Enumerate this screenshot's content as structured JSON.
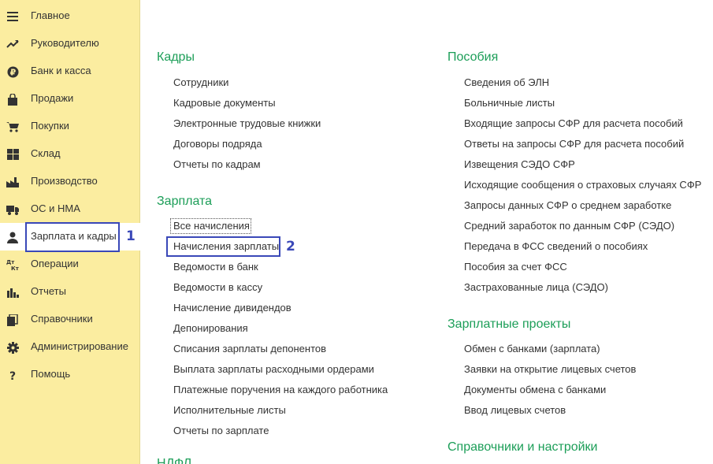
{
  "sidebar": {
    "items": [
      {
        "label": "Главное",
        "icon": "menu-icon"
      },
      {
        "label": "Руководителю",
        "icon": "trend-icon"
      },
      {
        "label": "Банк и касса",
        "icon": "ruble-icon"
      },
      {
        "label": "Продажи",
        "icon": "bag-icon"
      },
      {
        "label": "Покупки",
        "icon": "cart-icon"
      },
      {
        "label": "Склад",
        "icon": "warehouse-icon"
      },
      {
        "label": "Производство",
        "icon": "factory-icon"
      },
      {
        "label": "ОС и НМА",
        "icon": "truck-icon"
      },
      {
        "label": "Зарплата и кадры",
        "icon": "person-icon",
        "active": true
      },
      {
        "label": "Операции",
        "icon": "dt-kt-icon"
      },
      {
        "label": "Отчеты",
        "icon": "bar-chart-icon"
      },
      {
        "label": "Справочники",
        "icon": "books-icon"
      },
      {
        "label": "Администрирование",
        "icon": "gear-icon"
      },
      {
        "label": "Помощь",
        "icon": "question-icon"
      }
    ]
  },
  "annotations": {
    "marker1": "1",
    "marker2": "2",
    "color": "#3a48b8"
  },
  "colors": {
    "sidebar_bg": "#fbeda0",
    "section_title": "#1c9e58"
  },
  "left_column": {
    "kadry": {
      "title": "Кадры",
      "links": [
        "Сотрудники",
        "Кадровые документы",
        "Электронные трудовые книжки",
        "Договоры подряда",
        "Отчеты по кадрам"
      ]
    },
    "zarplata": {
      "title": "Зарплата",
      "links": [
        "Все начисления",
        "Начисления зарплаты",
        "Ведомости в банк",
        "Ведомости в кассу",
        "Начисление дивидендов",
        "Депонирования",
        "Списания зарплаты депонентов",
        "Выплата зарплаты расходными ордерами",
        "Платежные поручения на каждого работника",
        "Исполнительные листы",
        "Отчеты по зарплате"
      ]
    },
    "ndfl": {
      "title": "НДФЛ"
    }
  },
  "right_column": {
    "posobiya": {
      "title": "Пособия",
      "links": [
        "Сведения об ЭЛН",
        "Больничные листы",
        "Входящие запросы СФР для расчета пособий",
        "Ответы на запросы СФР для расчета пособий",
        "Извещения СЭДО СФР",
        "Исходящие сообщения о страховых случаях СФР",
        "Запросы данных СФР о среднем заработке",
        "Средний заработок по данным СФР (СЭДО)",
        "Передача в ФСС сведений о пособиях",
        "Пособия за счет ФСС",
        "Застрахованные лица (СЭДО)"
      ]
    },
    "zarplatnye": {
      "title": "Зарплатные проекты",
      "links": [
        "Обмен с банками (зарплата)",
        "Заявки на открытие лицевых счетов",
        "Документы обмена с банками",
        "Ввод лицевых счетов"
      ]
    },
    "spravochniki": {
      "title": "Справочники и настройки"
    }
  }
}
